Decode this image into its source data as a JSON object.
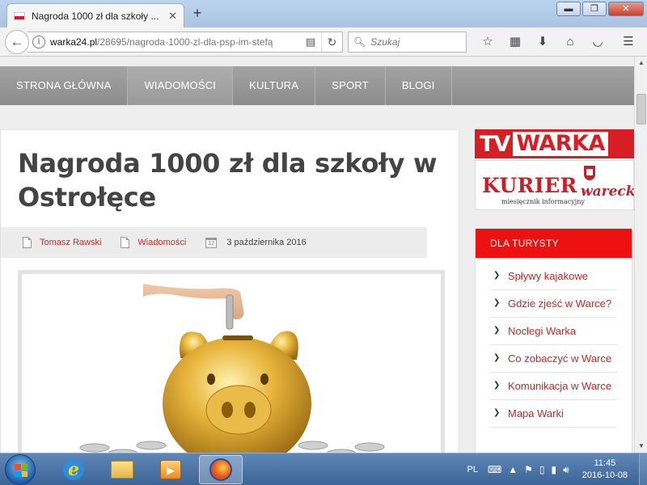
{
  "browser": {
    "tab_title": "Nagroda 1000 zł dla szkoły ...",
    "tab_close": "✕",
    "new_tab": "+",
    "url_host": "warka24.pl",
    "url_path": "/28695/nagroda-1000-zl-dla-psp-im-stefą",
    "search_placeholder": "Szukaj",
    "window_min": "▬",
    "window_restore": "❐",
    "window_close": "✕"
  },
  "site_nav": {
    "items": [
      "STRONA GŁÓWNA",
      "WIADOMOŚCI",
      "KULTURA",
      "SPORT",
      "BLOGI"
    ],
    "active_index": 1
  },
  "article": {
    "title": "Nagroda 1000 zł dla szkoły w Ostrołęce",
    "author": "Tomasz Rawski",
    "category": "Wiadomości",
    "calendar_day": "12",
    "date": "3 października 2016"
  },
  "sidebar": {
    "tv_logo_left": "TV",
    "tv_logo_right": "WARKA",
    "kurier_main": "KURIER",
    "kurier_suffix": "warecki",
    "kurier_sub": "miesięcznik informacyjny",
    "widget_title": "DLA TURYSTY",
    "widget_links": [
      "Spływy kajakowe",
      "Gdzie zjeść w Warce?",
      "Noclegi Warka",
      "Co zobaczyć w Warce",
      "Komunikacja w Warce",
      "Mapa Warki"
    ]
  },
  "taskbar": {
    "language": "PL",
    "time": "11:45",
    "date": "2016-10-08"
  },
  "colors": {
    "accent_red": "#ee1111",
    "link_red": "#c62828",
    "nav_gray": "#999999",
    "taskbar_blue": "#3b6597"
  }
}
